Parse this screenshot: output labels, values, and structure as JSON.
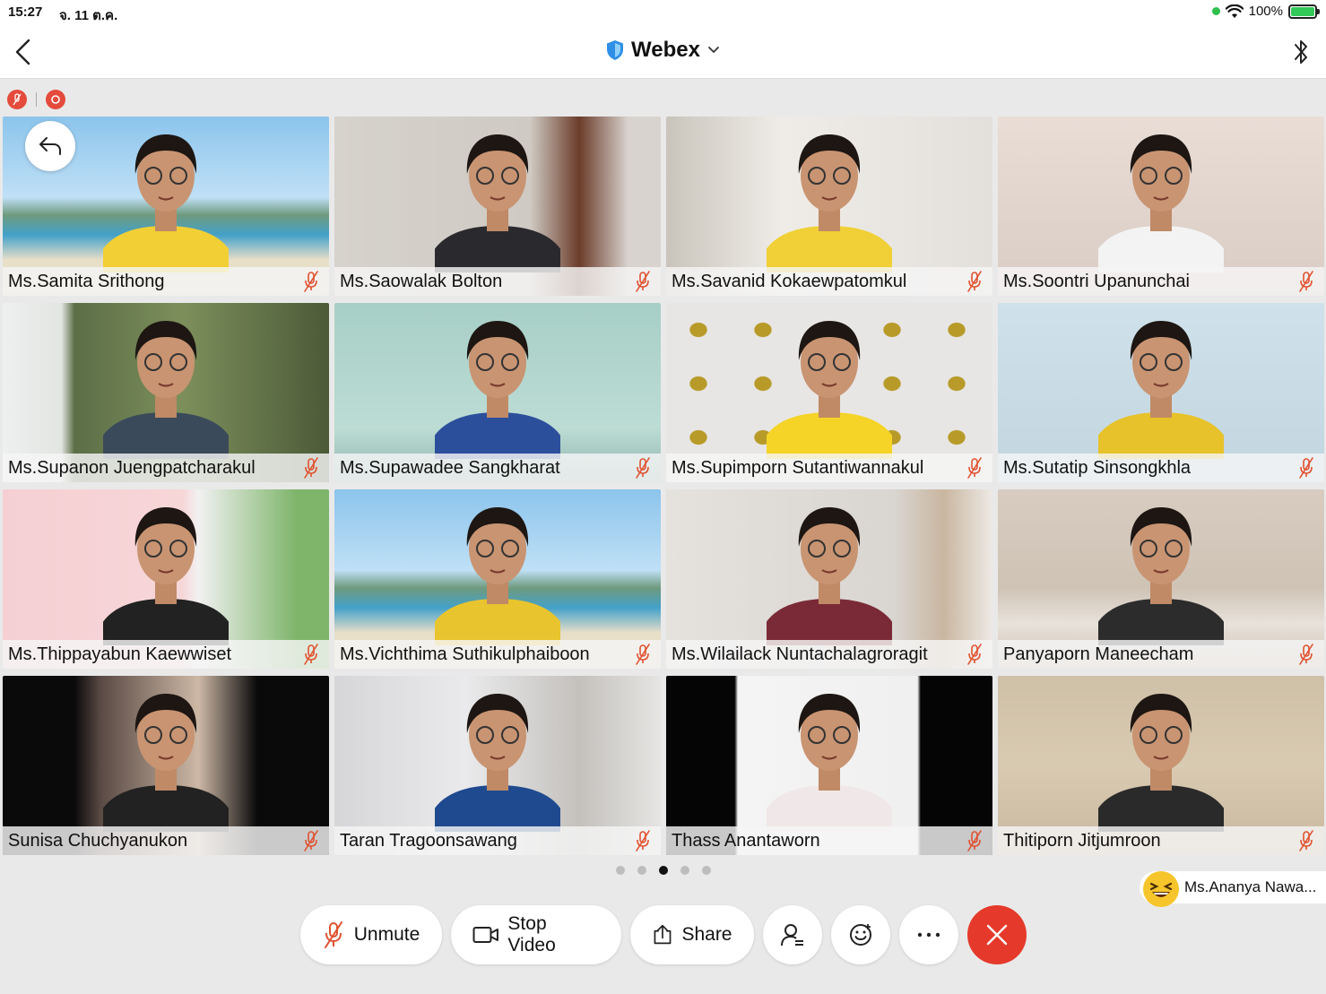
{
  "status_bar": {
    "time": "15:27",
    "date": "จ. 11 ต.ค.",
    "battery": "100%"
  },
  "nav": {
    "title": "Webex"
  },
  "participants": [
    {
      "name": "Ms.Samita Srithong",
      "bg": "beach",
      "shirt": "#f2cf35"
    },
    {
      "name": "Ms.Saowalak Bolton",
      "bg": "room",
      "shirt": "#2a2a2e"
    },
    {
      "name": "Ms.Savanid Kokaewpatomkul",
      "bg": "white",
      "shirt": "#f0d036"
    },
    {
      "name": "Ms.Soontri Upanunchai",
      "bg": "plain",
      "shirt": "#f3f3f3"
    },
    {
      "name": "Ms.Supanon Juengpatcharakul",
      "bg": "forest",
      "shirt": "#3a4a5a"
    },
    {
      "name": "Ms.Supawadee Sangkharat",
      "bg": "mint",
      "shirt": "#2c4f9c"
    },
    {
      "name": "Ms.Supimporn Sutantiwannakul",
      "bg": "tiles",
      "shirt": "#f5d327"
    },
    {
      "name": "Ms.Sutatip Sinsongkhla",
      "bg": "blue",
      "shirt": "#e7c22a"
    },
    {
      "name": "Ms.Thippayabun Kaewwiset",
      "bg": "cartoon",
      "shirt": "#222"
    },
    {
      "name": "Ms.Vichthima Suthikulphaiboon",
      "bg": "beach",
      "shirt": "#e8c42e"
    },
    {
      "name": "Ms.Wilailack Nuntachalagroragit",
      "bg": "office",
      "shirt": "#7a2a36"
    },
    {
      "name": "Panyaporn Maneecham",
      "bg": "living",
      "shirt": "#2c2c2c"
    },
    {
      "name": "Sunisa Chuchyanukon",
      "bg": "dark",
      "shirt": "#222"
    },
    {
      "name": "Taran Tragoonsawang",
      "bg": "kitchen",
      "shirt": "#1f4a8f"
    },
    {
      "name": "Thass Anantaworn",
      "bg": "darkwhite",
      "shirt": "#f0e8e8"
    },
    {
      "name": "Thitiporn Jitjumroon",
      "bg": "desk",
      "shirt": "#2a2a2a"
    }
  ],
  "self_view": {
    "name": "Ms.Ananya Nawa..."
  },
  "controls": {
    "unmute": "Unmute",
    "stop_video": "Stop Video",
    "share": "Share"
  },
  "pager": {
    "count": 5,
    "active_index": 2
  },
  "colors": {
    "accent_red": "#e53a2b",
    "status_red": "#e54b3c",
    "muted_mic": "#e0512f"
  }
}
